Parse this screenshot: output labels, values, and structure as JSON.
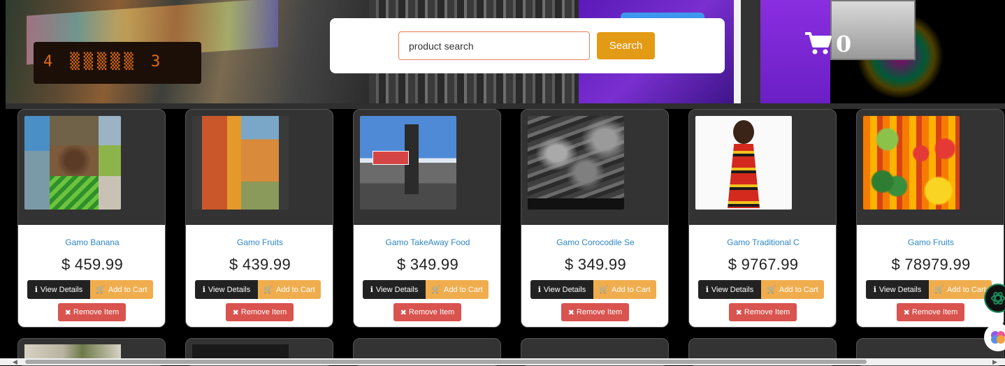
{
  "search": {
    "value": "product search",
    "placeholder": "",
    "button_label": "Search"
  },
  "cart": {
    "count": "0",
    "icon": "shopping-cart-icon"
  },
  "buttons": {
    "view_details": "View Details",
    "add_to_cart": "Add to Cart",
    "remove_item": "Remove Item"
  },
  "products": [
    {
      "name": "Gamo Banana",
      "price": "$ 459.99"
    },
    {
      "name": "Gamo Fruits",
      "price": "$ 439.99"
    },
    {
      "name": "Gamo TakeAway Food",
      "price": "$ 349.99"
    },
    {
      "name": "Gamo Corocodile Se",
      "price": "$ 349.99"
    },
    {
      "name": "Gamo Traditional C",
      "price": "$ 9767.99"
    },
    {
      "name": "Gamo Fruits",
      "price": "$ 78979.99"
    }
  ],
  "colors": {
    "search_button": "#e39a14",
    "add_to_cart": "#f0ad4e",
    "remove_item": "#d9534f",
    "view_details": "#222222",
    "product_name": "#2e86c9"
  }
}
